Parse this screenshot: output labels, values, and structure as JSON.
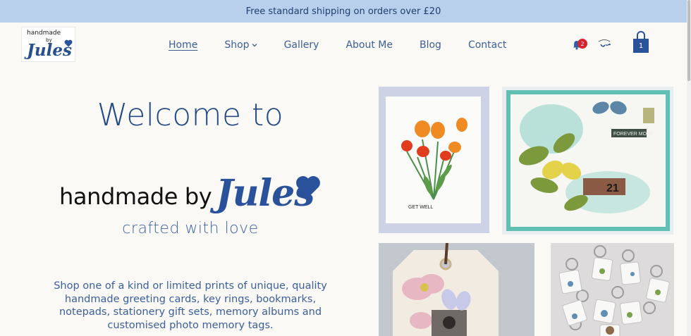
{
  "announcement": "Free standard shipping on orders over £20",
  "logo": {
    "line1": "handmade",
    "line2": "by",
    "line3": "Jules"
  },
  "nav": {
    "items": [
      "Home",
      "Shop",
      "Gallery",
      "About Me",
      "Blog",
      "Contact"
    ],
    "active": "Home"
  },
  "header_icons": {
    "notifications": {
      "icon": "bell-icon",
      "count": "2"
    },
    "cart": {
      "icon": "shopping-bag-icon",
      "count": "1"
    }
  },
  "hero": {
    "welcome": "Welcome to",
    "brand_text": "handmade by",
    "brand_script": "Jules",
    "tagline": "crafted with love",
    "intro": "Shop one of a kind or limited prints of unique, quality handmade greeting cards, key rings, bookmarks, notepads, stationery gift sets, memory albums and customised photo memory tags."
  },
  "gallery": {
    "card_text": "GET WELL",
    "stamp_text": "FOREVER MORE",
    "ticket_number": "21"
  },
  "colors": {
    "brand_blue": "#2a529a",
    "announcement_bg": "#b9d0ec",
    "badge_red": "#d8232a"
  }
}
